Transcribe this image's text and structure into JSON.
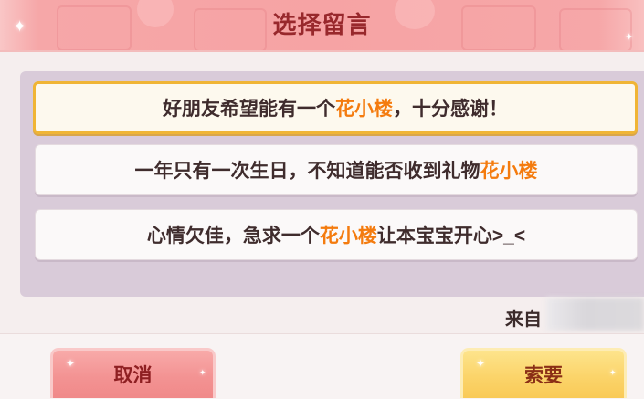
{
  "dialog": {
    "title": "选择留言",
    "options": [
      {
        "before": "好朋友希望能有一个",
        "highlight": "花小楼",
        "after": "，十分感谢！",
        "selected": true
      },
      {
        "before": "一年只有一次生日，不知道能否收到礼物",
        "highlight": "花小楼",
        "selected": false
      },
      {
        "before": "心情欠佳，急求一个",
        "highlight": "花小楼",
        "after": "让本宝宝开心>_<",
        "selected": false
      }
    ],
    "from_label": "来自"
  },
  "buttons": {
    "cancel": "取消",
    "request": "索要"
  },
  "icons": {
    "sparkle": "sparkle-icon"
  },
  "colors": {
    "header_bg": "#f6a3a4",
    "title_text": "#98282c",
    "panel_bg": "#d9cbd9",
    "selected_border": "#f0b535",
    "highlight_text": "#f47b0e",
    "cancel_button": "#f39393",
    "request_button": "#fbd46a"
  }
}
